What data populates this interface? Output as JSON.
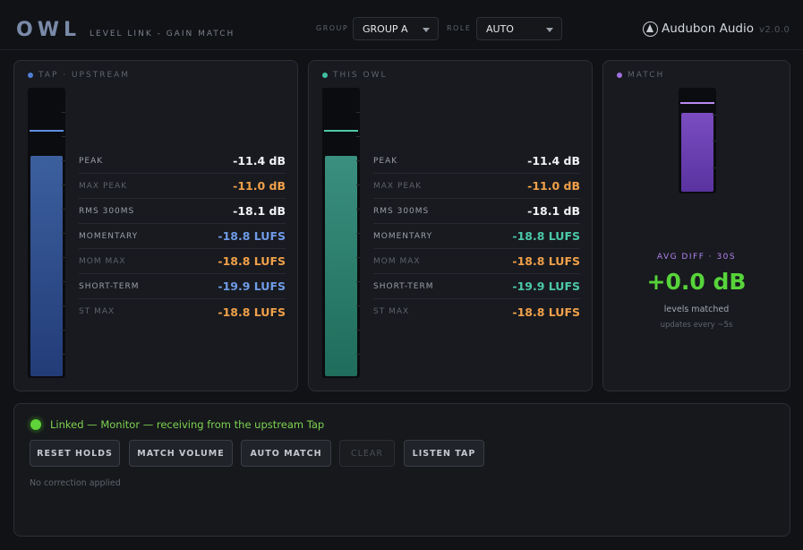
{
  "header": {
    "logo": "OWL",
    "subtitle": "LEVEL LINK - GAIN MATCH",
    "group_label": "GROUP",
    "group_value": "GROUP A",
    "role_label": "ROLE",
    "role_value": "AUTO",
    "brand": "Audubon Audio",
    "version": "v2.0.0"
  },
  "colors": {
    "upstream_accent": "#4f7fd4",
    "owl_accent": "#3fbfa0",
    "match_accent": "#a070e0",
    "value_orange": "#f0a04a",
    "value_blue": "#6f9be6",
    "value_teal": "#4cc8a8",
    "match_green": "#57d43a"
  },
  "upstream": {
    "title": "TAP · UPSTREAM",
    "meter_level": 0.77,
    "hold_level": 0.86,
    "stats": [
      {
        "label": "PEAK",
        "value": "-11.4 dB"
      },
      {
        "label": "MAX PEAK",
        "value": "-11.0 dB"
      },
      {
        "label": "RMS 300MS",
        "value": "-18.1 dB"
      },
      {
        "label": "MOMENTARY",
        "value": "-18.8 LUFS"
      },
      {
        "label": "MOM MAX",
        "value": "-18.8 LUFS"
      },
      {
        "label": "SHORT-TERM",
        "value": "-19.9 LUFS"
      },
      {
        "label": "ST MAX",
        "value": "-18.8 LUFS"
      }
    ]
  },
  "owl": {
    "title": "THIS OWL",
    "meter_level": 0.77,
    "hold_level": 0.86,
    "stats": [
      {
        "label": "PEAK",
        "value": "-11.4 dB"
      },
      {
        "label": "MAX PEAK",
        "value": "-11.0 dB"
      },
      {
        "label": "RMS 300MS",
        "value": "-18.1 dB"
      },
      {
        "label": "MOMENTARY",
        "value": "-18.8 LUFS"
      },
      {
        "label": "MOM MAX",
        "value": "-18.8 LUFS"
      },
      {
        "label": "SHORT-TERM",
        "value": "-19.9 LUFS"
      },
      {
        "label": "ST MAX",
        "value": "-18.8 LUFS"
      }
    ]
  },
  "match": {
    "title": "MATCH",
    "meter_level": 0.77,
    "hold_level": 0.88,
    "avg_label": "AVG DIFF · 30S",
    "avg_value": "+0.0 dB",
    "status": "levels matched",
    "note": "updates every ~5s"
  },
  "bottom": {
    "link_status": "Linked — Monitor — receiving from the upstream Tap",
    "buttons": {
      "reset_holds": "RESET HOLDS",
      "match_volume": "MATCH VOLUME",
      "auto_match": "AUTO MATCH",
      "clear": "CLEAR",
      "listen_tap": "LISTEN TAP"
    },
    "correction": "No correction applied"
  }
}
